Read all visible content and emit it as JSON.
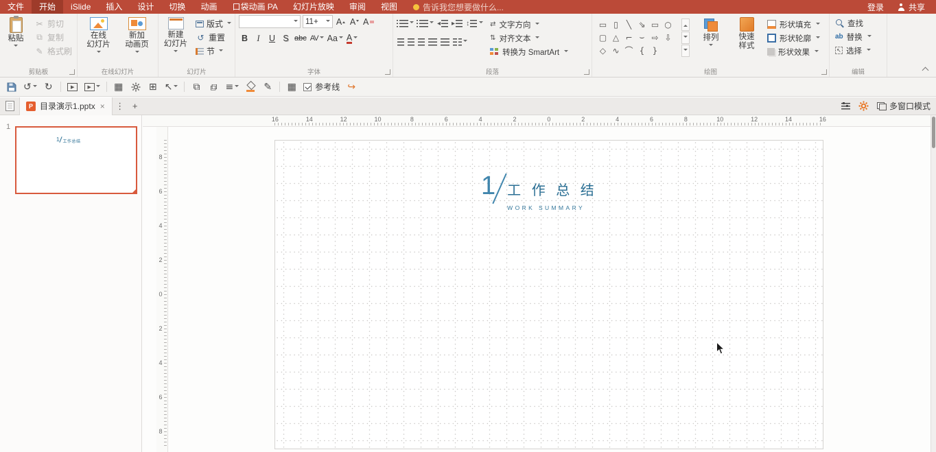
{
  "colors": {
    "accent": "#bb4a38",
    "title_blue": "#2b6f94",
    "selection_orange": "#d8593c",
    "gear_orange": "#e8731f"
  },
  "menubar": {
    "items": [
      "文件",
      "开始",
      "iSlide",
      "插入",
      "设计",
      "切换",
      "动画",
      "口袋动画 PA",
      "幻灯片放映",
      "审阅",
      "视图"
    ],
    "active_index": 1,
    "tell_me": "告诉我您想要做什么...",
    "login": "登录",
    "share": "共享"
  },
  "ribbon": {
    "clipboard": {
      "group_label": "剪贴板",
      "paste": "粘贴",
      "cut": "剪切",
      "copy": "复制",
      "format_painter": "格式刷"
    },
    "online_slides": {
      "group_label": "在线幻灯片",
      "online_l1": "在线",
      "online_l2": "幻灯片",
      "new_anim_l1": "新加",
      "new_anim_l2": "动画页"
    },
    "slides": {
      "group_label": "幻灯片",
      "new_slide_l1": "新建",
      "new_slide_l2": "幻灯片",
      "layout": "版式",
      "reset": "重置",
      "section": "节"
    },
    "font": {
      "group_label": "字体",
      "font_name": "",
      "font_size": "11+",
      "bold": "B",
      "italic": "I",
      "underline": "U",
      "shadow": "S",
      "strike": "abc",
      "char_spacing": "AV",
      "change_case": "Aa",
      "font_color": "A",
      "inc_font": "A",
      "dec_font": "A",
      "clear_format": "A"
    },
    "paragraph": {
      "group_label": "段落",
      "text_direction": "文字方向",
      "align_text": "对齐文本",
      "smartart": "转换为 SmartArt"
    },
    "drawing": {
      "group_label": "绘图",
      "arrange": "排列",
      "quick_l1": "快速",
      "quick_l2": "样式",
      "fill": "形状填充",
      "outline": "形状轮廓",
      "effects": "形状效果",
      "shapes": [
        "▭",
        "▯",
        "╲",
        "⇘",
        "▭",
        "○",
        "▢",
        "△",
        "⌐",
        "⌣",
        "⇨",
        "⇩",
        "◇",
        "∿",
        "⌒",
        "{",
        "}"
      ]
    },
    "edit": {
      "group_label": "编辑",
      "find": "查找",
      "replace": "替换",
      "select": "选择"
    }
  },
  "icons": {
    "cut": "✂",
    "copy": "⧉",
    "format_painter": "✎",
    "reset": "↺",
    "undo": "↺",
    "redo": "↻",
    "play": "▶",
    "grid": "▦",
    "pan": "⊞",
    "select_arrow": "↖",
    "layer_up": "⧉",
    "layer_down": "⧉",
    "align": "≡",
    "pencil": "✎",
    "table": "▦",
    "orange_redo": "↪",
    "ppt": "P",
    "close": "×",
    "more": "⋮",
    "add": "+",
    "replace_ab": "ab",
    "dec_indent": "◂",
    "inc_indent": "▸",
    "line_spacing": "↕",
    "valign": "⇅",
    "textdir": "⇄"
  },
  "quickbar": {
    "guides_label": "参考线",
    "guides_checked": true
  },
  "tabbar": {
    "doc_title": "目录演示1.pptx",
    "multi_window": "多窗口模式"
  },
  "slide_panel": {
    "slide_number": "1"
  },
  "rulers": {
    "horizontal": [
      "16",
      "14",
      "12",
      "10",
      "8",
      "6",
      "4",
      "2",
      "0",
      "2",
      "4",
      "6",
      "8",
      "10",
      "12",
      "14",
      "16"
    ],
    "vertical": [
      "8",
      "6",
      "4",
      "2",
      "0",
      "2",
      "4",
      "6",
      "8"
    ]
  },
  "slide": {
    "number": "1",
    "title": "工 作 总 结",
    "subtitle": "WORK SUMMARY"
  },
  "thumbnail": {
    "number": "1",
    "title": "工作总结"
  }
}
